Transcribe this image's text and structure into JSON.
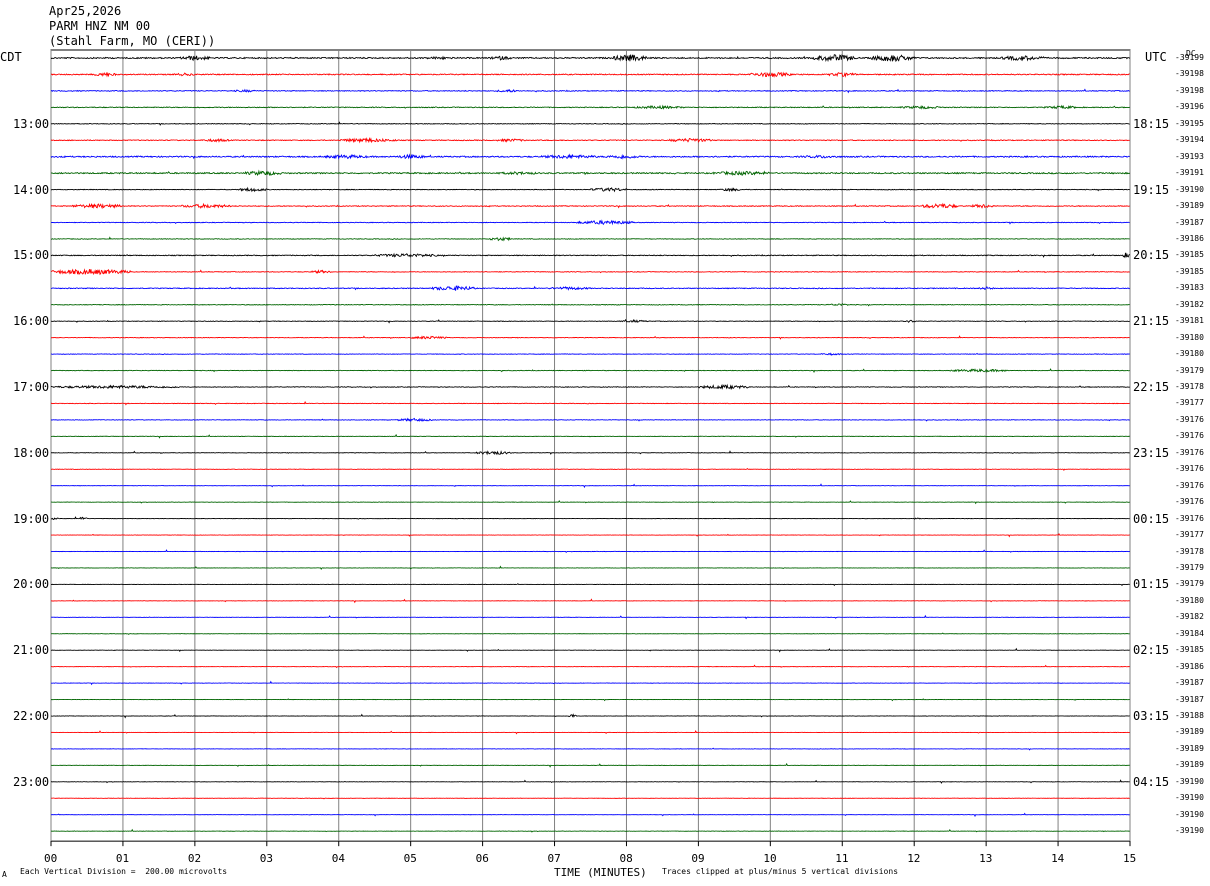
{
  "header": {
    "date": "Apr25,2026",
    "station": "PARM HNZ NM 00",
    "location": "(Stahl Farm, MO (CERI))"
  },
  "labels": {
    "left_timezone": "CDT",
    "right_timezone": "UTC",
    "dc": "DC"
  },
  "footer": {
    "marker": "A",
    "scale": "Each Vertical Division =  200.00 microvolts",
    "clip_note": "Traces clipped at plus/minus 5 vertical divisions"
  },
  "colors": {
    "trace_cycle": [
      "#000000",
      "#ff0000",
      "#0000ff",
      "#006400"
    ],
    "grid": "#808080",
    "background": "#ffffff"
  },
  "chart_data": {
    "type": "line",
    "description_style": "helicorder",
    "xlabel": "TIME (MINUTES)",
    "xlim": [
      0,
      15
    ],
    "x_ticks": [
      "00",
      "01",
      "02",
      "03",
      "04",
      "05",
      "06",
      "07",
      "08",
      "09",
      "10",
      "11",
      "12",
      "13",
      "14",
      "15"
    ],
    "left_hour_labels": [
      {
        "row": 4,
        "label": "13:00"
      },
      {
        "row": 8,
        "label": "14:00"
      },
      {
        "row": 12,
        "label": "15:00"
      },
      {
        "row": 16,
        "label": "16:00"
      },
      {
        "row": 20,
        "label": "17:00"
      },
      {
        "row": 24,
        "label": "18:00"
      },
      {
        "row": 28,
        "label": "19:00"
      },
      {
        "row": 32,
        "label": "20:00"
      },
      {
        "row": 36,
        "label": "21:00"
      },
      {
        "row": 40,
        "label": "22:00"
      },
      {
        "row": 44,
        "label": "23:00"
      }
    ],
    "right_hour_labels": [
      {
        "row": 4,
        "label": "18:15"
      },
      {
        "row": 8,
        "label": "19:15"
      },
      {
        "row": 12,
        "label": "20:15"
      },
      {
        "row": 16,
        "label": "21:15"
      },
      {
        "row": 20,
        "label": "22:15"
      },
      {
        "row": 24,
        "label": "23:15"
      },
      {
        "row": 28,
        "label": "00:15"
      },
      {
        "row": 32,
        "label": "01:15"
      },
      {
        "row": 36,
        "label": "02:15"
      },
      {
        "row": 40,
        "label": "03:15"
      },
      {
        "row": 44,
        "label": "04:15"
      }
    ],
    "dc_offsets": [
      "-39199",
      "-39198",
      "-39198",
      "-39196",
      "-39195",
      "-39194",
      "-39193",
      "-39191",
      "-39190",
      "-39189",
      "-39187",
      "-39186",
      "-39185",
      "-39185",
      "-39183",
      "-39182",
      "-39181",
      "-39180",
      "-39180",
      "-39179",
      "-39178",
      "-39177",
      "-39176",
      "-39176",
      "-39176",
      "-39176",
      "-39176",
      "-39176",
      "-39176",
      "-39177",
      "-39178",
      "-39179",
      "-39179",
      "-39180",
      "-39182",
      "-39184",
      "-39185",
      "-39186",
      "-39187",
      "-39187",
      "-39188",
      "-39189",
      "-39189",
      "-39189",
      "-39190",
      "-39190",
      "-39190",
      "-39190"
    ],
    "trace_activity": [
      {
        "row": 0,
        "base": 0.6,
        "bursts": [
          [
            1.8,
            2.2,
            2.5
          ],
          [
            5.2,
            5.6,
            1.5
          ],
          [
            6.1,
            6.4,
            2
          ],
          [
            7.8,
            8.3,
            3.5
          ],
          [
            10.6,
            11.2,
            3.5
          ],
          [
            11.4,
            12.0,
            3.5
          ],
          [
            13.2,
            13.8,
            2.5
          ]
        ]
      },
      {
        "row": 1,
        "base": 0.5,
        "bursts": [
          [
            0.6,
            0.9,
            2
          ],
          [
            1.7,
            2.0,
            1.5
          ],
          [
            9.7,
            10.3,
            2.5
          ],
          [
            10.8,
            11.2,
            2
          ]
        ]
      },
      {
        "row": 2,
        "base": 0.4,
        "bursts": [
          [
            2.5,
            2.9,
            1.2
          ],
          [
            6.2,
            6.5,
            1.5
          ]
        ]
      },
      {
        "row": 3,
        "base": 0.4,
        "bursts": [
          [
            8.1,
            8.8,
            1.5
          ],
          [
            11.8,
            12.4,
            1.5
          ],
          [
            13.8,
            14.3,
            1.5
          ]
        ]
      },
      {
        "row": 4,
        "base": 0.3,
        "bursts": []
      },
      {
        "row": 5,
        "base": 0.4,
        "bursts": [
          [
            2.1,
            2.5,
            1.5
          ],
          [
            4.0,
            4.8,
            2
          ],
          [
            6.2,
            6.6,
            1.5
          ],
          [
            8.6,
            9.2,
            2
          ]
        ]
      },
      {
        "row": 6,
        "base": 0.6,
        "bursts": [
          [
            3.8,
            4.4,
            2
          ],
          [
            4.8,
            5.2,
            2.2
          ],
          [
            6.8,
            7.6,
            2
          ],
          [
            7.7,
            8.2,
            2
          ],
          [
            10.4,
            11.0,
            1.5
          ]
        ]
      },
      {
        "row": 7,
        "base": 0.6,
        "bursts": [
          [
            2.7,
            3.2,
            2.5
          ],
          [
            6.2,
            6.8,
            1.5
          ],
          [
            9.2,
            10.0,
            2
          ]
        ]
      },
      {
        "row": 8,
        "base": 0.3,
        "bursts": [
          [
            2.6,
            3.0,
            1.8
          ],
          [
            7.5,
            8.0,
            2
          ],
          [
            9.3,
            9.6,
            1.5
          ]
        ]
      },
      {
        "row": 9,
        "base": 0.4,
        "bursts": [
          [
            0.3,
            1.0,
            2.2
          ],
          [
            1.8,
            2.5,
            2
          ],
          [
            12.1,
            12.6,
            2.5
          ],
          [
            12.8,
            13.1,
            2
          ]
        ]
      },
      {
        "row": 10,
        "base": 0.3,
        "bursts": [
          [
            7.3,
            8.1,
            2
          ]
        ]
      },
      {
        "row": 11,
        "base": 0.3,
        "bursts": [
          [
            6.1,
            6.4,
            1.8
          ]
        ]
      },
      {
        "row": 12,
        "base": 0.4,
        "bursts": [
          [
            4.5,
            5.4,
            1.8
          ],
          [
            14.9,
            15.0,
            3
          ]
        ]
      },
      {
        "row": 13,
        "base": 0.3,
        "bursts": [
          [
            0.0,
            1.1,
            2.8
          ],
          [
            3.6,
            3.9,
            1.5
          ]
        ]
      },
      {
        "row": 14,
        "base": 0.4,
        "bursts": [
          [
            5.3,
            5.9,
            2.5
          ],
          [
            6.9,
            7.5,
            1.5
          ],
          [
            12.9,
            13.1,
            1.5
          ]
        ]
      },
      {
        "row": 15,
        "base": 0.3,
        "bursts": [
          [
            10.8,
            11.1,
            1.2
          ]
        ]
      },
      {
        "row": 16,
        "base": 0.25,
        "bursts": [
          [
            7.9,
            8.3,
            1.2
          ],
          [
            11.8,
            12.1,
            1.2
          ]
        ]
      },
      {
        "row": 17,
        "base": 0.25,
        "bursts": [
          [
            5.0,
            5.5,
            1.5
          ]
        ]
      },
      {
        "row": 18,
        "base": 0.25,
        "bursts": [
          [
            10.7,
            11.0,
            1
          ]
        ]
      },
      {
        "row": 19,
        "base": 0.25,
        "bursts": [
          [
            12.5,
            13.3,
            1.5
          ]
        ]
      },
      {
        "row": 20,
        "base": 0.3,
        "bursts": [
          [
            0.0,
            1.8,
            1.5
          ],
          [
            9.0,
            9.7,
            2
          ]
        ]
      },
      {
        "row": 21,
        "base": 0.25,
        "bursts": []
      },
      {
        "row": 22,
        "base": 0.25,
        "bursts": [
          [
            4.8,
            5.3,
            1.5
          ]
        ]
      },
      {
        "row": 23,
        "base": 0.2,
        "bursts": []
      },
      {
        "row": 24,
        "base": 0.2,
        "bursts": [
          [
            5.9,
            6.4,
            1.8
          ]
        ]
      },
      {
        "row": 25,
        "base": 0.2,
        "bursts": []
      },
      {
        "row": 26,
        "base": 0.15,
        "bursts": []
      },
      {
        "row": 27,
        "base": 0.15,
        "bursts": []
      },
      {
        "row": 28,
        "base": 0.15,
        "bursts": [
          [
            0.0,
            0.1,
            1
          ],
          [
            0.4,
            0.5,
            3
          ],
          [
            12.0,
            12.1,
            1
          ]
        ]
      },
      {
        "row": 29,
        "base": 0.15,
        "bursts": []
      },
      {
        "row": 30,
        "base": 0.15,
        "bursts": []
      },
      {
        "row": 31,
        "base": 0.15,
        "bursts": []
      },
      {
        "row": 32,
        "base": 0.15,
        "bursts": []
      },
      {
        "row": 33,
        "base": 0.15,
        "bursts": []
      },
      {
        "row": 34,
        "base": 0.15,
        "bursts": []
      },
      {
        "row": 35,
        "base": 0.15,
        "bursts": []
      },
      {
        "row": 36,
        "base": 0.15,
        "bursts": []
      },
      {
        "row": 37,
        "base": 0.15,
        "bursts": []
      },
      {
        "row": 38,
        "base": 0.15,
        "bursts": []
      },
      {
        "row": 39,
        "base": 0.15,
        "bursts": []
      },
      {
        "row": 40,
        "base": 0.15,
        "bursts": [
          [
            7.2,
            7.3,
            2
          ]
        ]
      },
      {
        "row": 41,
        "base": 0.15,
        "bursts": []
      },
      {
        "row": 42,
        "base": 0.15,
        "bursts": []
      },
      {
        "row": 43,
        "base": 0.15,
        "bursts": []
      },
      {
        "row": 44,
        "base": 0.15,
        "bursts": []
      },
      {
        "row": 45,
        "base": 0.15,
        "bursts": []
      },
      {
        "row": 46,
        "base": 0.15,
        "bursts": []
      },
      {
        "row": 47,
        "base": 0.15,
        "bursts": []
      }
    ]
  }
}
